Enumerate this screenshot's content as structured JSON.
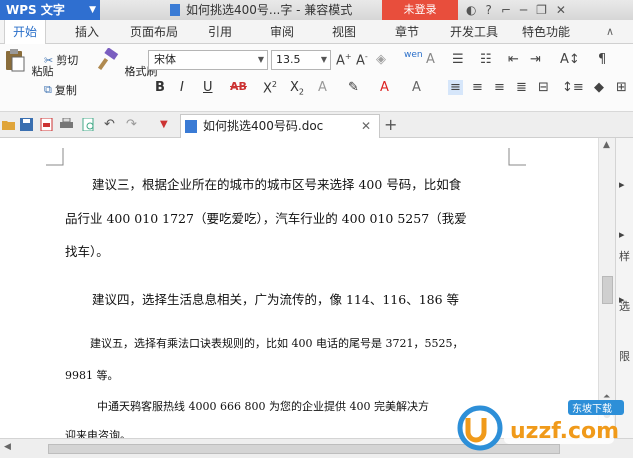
{
  "app": {
    "menu_label": "WPS 文字",
    "title": "如何挑选400号...字 - 兼容模式",
    "login_label": "未登录"
  },
  "menu": {
    "tabs": [
      "开始",
      "插入",
      "页面布局",
      "引用",
      "审阅",
      "视图",
      "章节",
      "开发工具",
      "特色功能"
    ]
  },
  "ribbon": {
    "paste": "粘贴",
    "cut": "剪切",
    "copy": "复制",
    "format_painter": "格式刷",
    "font_name": "宋体",
    "font_size": "13.5",
    "phonetic": "wen"
  },
  "document": {
    "tab_title": "如何挑选400号码.doc",
    "paragraphs": [
      "建议三，根据企业所在的城市的城市区号来选择 400 号码，比如食",
      "品行业 400  010  1727（要吃爱吃），汽车行业的 400  010  5257（我爱",
      "找车）。",
      "建议四，选择生活息息相关，广为流传的，像 114、116、186 等",
      "建议五，选择有乘法口诀表规则的，比如 400 电话的尾号是 3721，5525，",
      "9981 等。",
      "中通天鸦客服热线 4000 666 800 为您的企业提供 400 完美解决方",
      "迎来电咨询。"
    ]
  },
  "side_panel": {
    "labels": [
      "样",
      "选",
      "限"
    ]
  },
  "watermark": {
    "site": "uzzf.com",
    "caption": "东坡下载"
  },
  "colors": {
    "brand_blue": "#2f6fd0",
    "login_red": "#e84e3c",
    "active_tab": "#2a6fc9"
  }
}
